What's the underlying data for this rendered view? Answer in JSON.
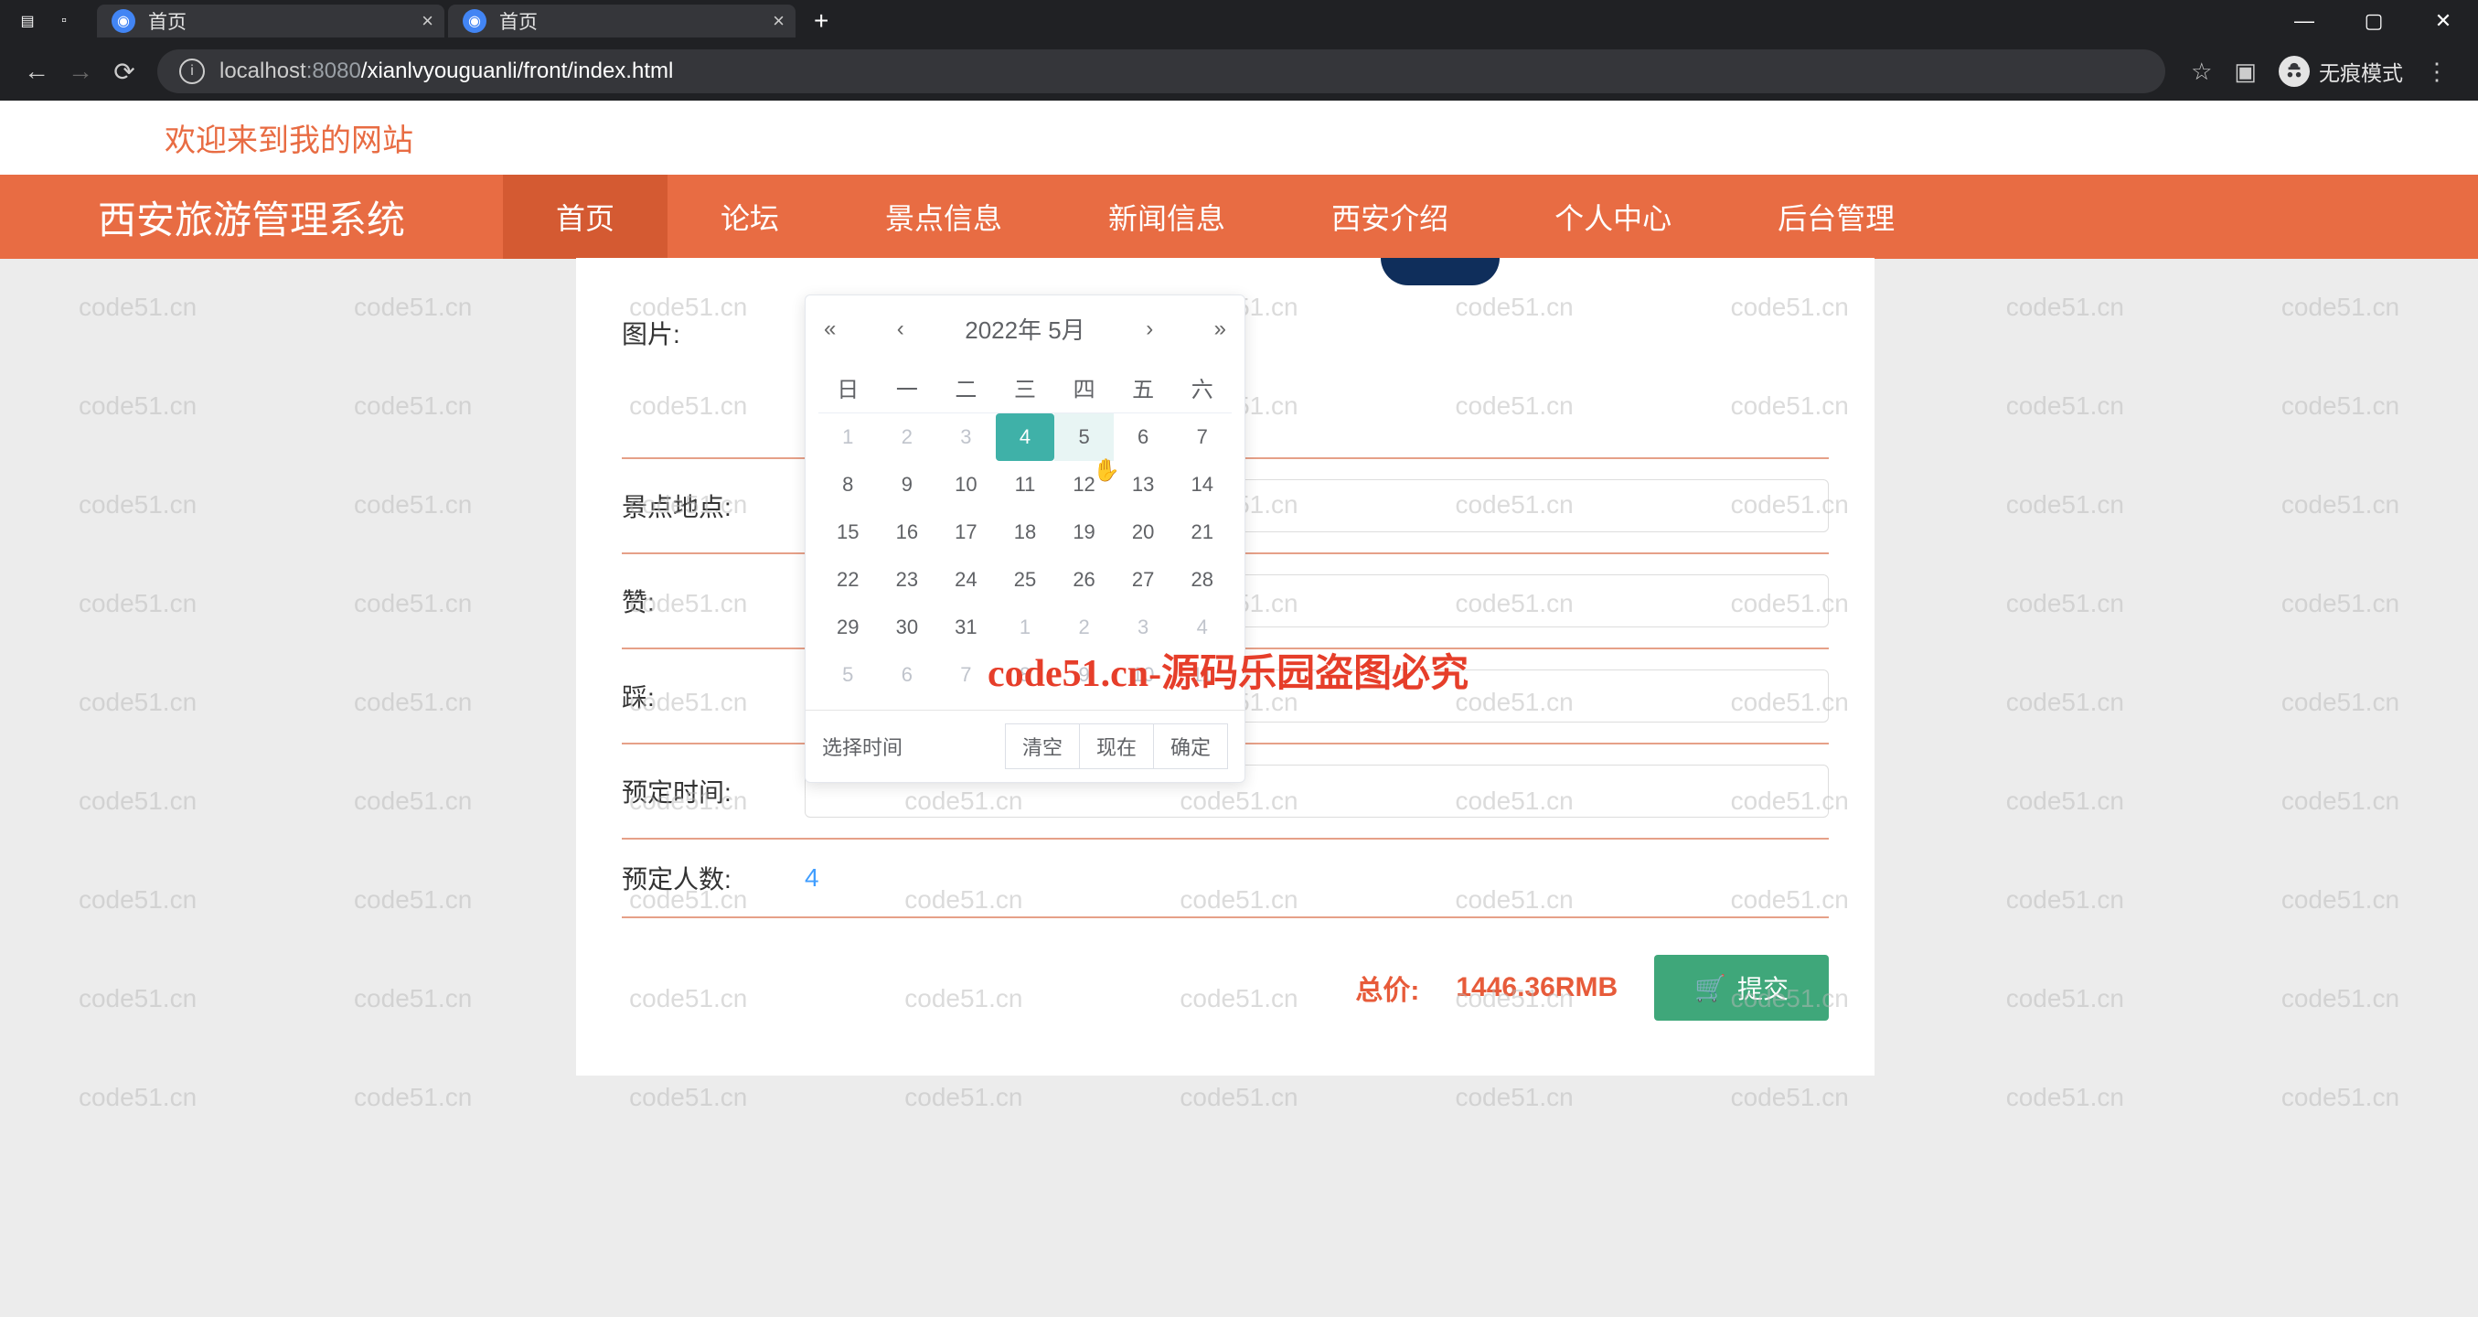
{
  "browser": {
    "tabs": [
      {
        "title": "首页"
      },
      {
        "title": "首页"
      }
    ],
    "url_host": "localhost",
    "url_port": ":8080",
    "url_path": "/xianlvyouguanli/front/index.html",
    "incognito_label": "无痕模式"
  },
  "page": {
    "welcome": "欢迎来到我的网站",
    "site_title": "西安旅游管理系统",
    "nav": [
      "首页",
      "论坛",
      "景点信息",
      "新闻信息",
      "西安介绍",
      "个人中心",
      "后台管理"
    ],
    "nav_active_index": 0
  },
  "form": {
    "image_label": "图片:",
    "location_label": "景点地点:",
    "zan_label": "赞:",
    "cai_label": "踩:",
    "time_label": "预定时间:",
    "count_label": "预定人数:",
    "count_value": "4",
    "total_label": "总价:",
    "total_value": "1446.36RMB",
    "submit_label": "提交"
  },
  "datepicker": {
    "title": "2022年  5月",
    "dow": [
      "日",
      "一",
      "二",
      "三",
      "四",
      "五",
      "六"
    ],
    "rows": [
      [
        {
          "d": "1",
          "m": true
        },
        {
          "d": "2",
          "m": true
        },
        {
          "d": "3",
          "m": true
        },
        {
          "d": "4",
          "sel": true
        },
        {
          "d": "5",
          "hov": true
        },
        {
          "d": "6"
        },
        {
          "d": "7"
        }
      ],
      [
        {
          "d": "8"
        },
        {
          "d": "9"
        },
        {
          "d": "10"
        },
        {
          "d": "11"
        },
        {
          "d": "12"
        },
        {
          "d": "13"
        },
        {
          "d": "14"
        }
      ],
      [
        {
          "d": "15"
        },
        {
          "d": "16"
        },
        {
          "d": "17"
        },
        {
          "d": "18"
        },
        {
          "d": "19"
        },
        {
          "d": "20"
        },
        {
          "d": "21"
        }
      ],
      [
        {
          "d": "22"
        },
        {
          "d": "23"
        },
        {
          "d": "24"
        },
        {
          "d": "25"
        },
        {
          "d": "26"
        },
        {
          "d": "27"
        },
        {
          "d": "28"
        }
      ],
      [
        {
          "d": "29"
        },
        {
          "d": "30"
        },
        {
          "d": "31"
        },
        {
          "d": "1",
          "m": true
        },
        {
          "d": "2",
          "m": true
        },
        {
          "d": "3",
          "m": true
        },
        {
          "d": "4",
          "m": true
        }
      ],
      [
        {
          "d": "5",
          "m": true
        },
        {
          "d": "6",
          "m": true
        },
        {
          "d": "7",
          "m": true
        },
        {
          "d": "8",
          "m": true
        },
        {
          "d": "9",
          "m": true
        },
        {
          "d": "10",
          "m": true
        },
        {
          "d": "11",
          "m": true
        }
      ]
    ],
    "select_time": "选择时间",
    "clear": "清空",
    "now": "现在",
    "ok": "确定"
  },
  "watermark": {
    "text": "code51.cn",
    "center": "code51.cn-源码乐园盗图必究"
  }
}
